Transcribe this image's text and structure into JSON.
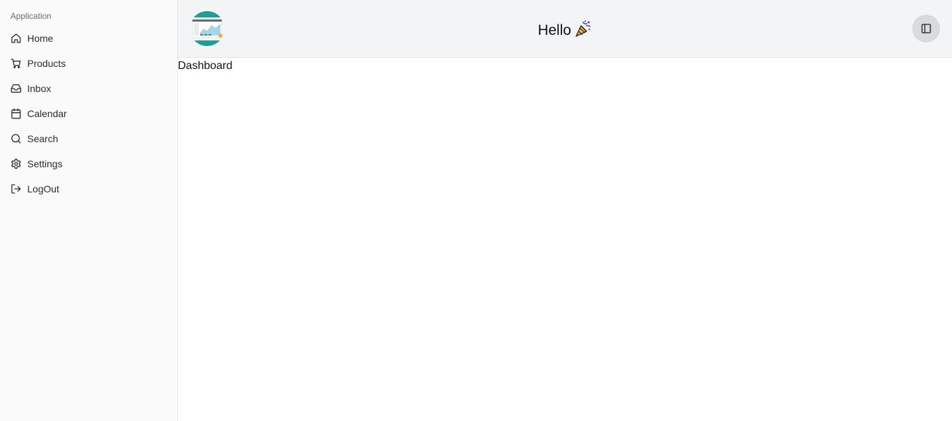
{
  "sidebar": {
    "group_label": "Application",
    "items": [
      {
        "label": "Home",
        "icon": "home-icon"
      },
      {
        "label": "Products",
        "icon": "cart-icon"
      },
      {
        "label": "Inbox",
        "icon": "inbox-icon"
      },
      {
        "label": "Calendar",
        "icon": "calendar-icon"
      },
      {
        "label": "Search",
        "icon": "search-icon"
      },
      {
        "label": "Settings",
        "icon": "gear-icon"
      },
      {
        "label": "LogOut",
        "icon": "logout-icon"
      }
    ]
  },
  "header": {
    "greeting": "Hello",
    "greeting_emoji": "party-popper-icon",
    "toggle_icon": "panel-left-icon"
  },
  "main": {
    "title": "Dashboard"
  },
  "colors": {
    "sidebar_bg": "#fafafa",
    "header_bg": "#f3f4f6",
    "toggle_bg": "#d9dadd"
  }
}
